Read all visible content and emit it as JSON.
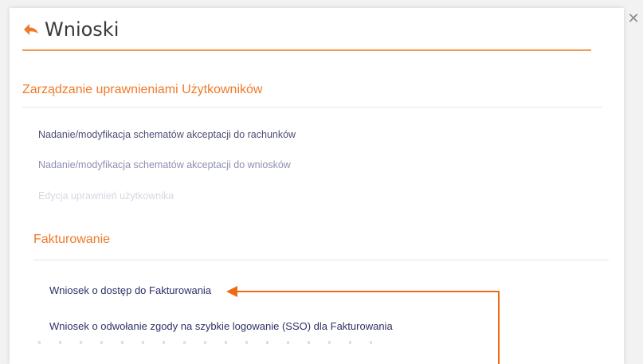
{
  "header": {
    "title": "Wnioski",
    "back_icon": "arrow-back-icon",
    "close_icon": "close-icon",
    "close_glyph": "✕"
  },
  "sections": [
    {
      "title": "Zarządzanie uprawnieniami Użytkowników",
      "items": [
        "Nadanie/modyfikacja schematów akceptacji do rachunków",
        "Nadanie/modyfikacja schematów akceptacji do wniosków",
        "Edycja uprawnień użytkownika"
      ]
    },
    {
      "title": "Fakturowanie",
      "items": [
        "Wniosek o dostęp do Fakturowania",
        "Wniosek o odwołanie zgody na szybkie logowanie (SSO) dla Fakturowania"
      ]
    }
  ],
  "colors": {
    "accent": "#f07a28",
    "title_text": "#3a3a3a",
    "link_text": "#2f3066",
    "annotation_arrow": "#f06a10"
  }
}
